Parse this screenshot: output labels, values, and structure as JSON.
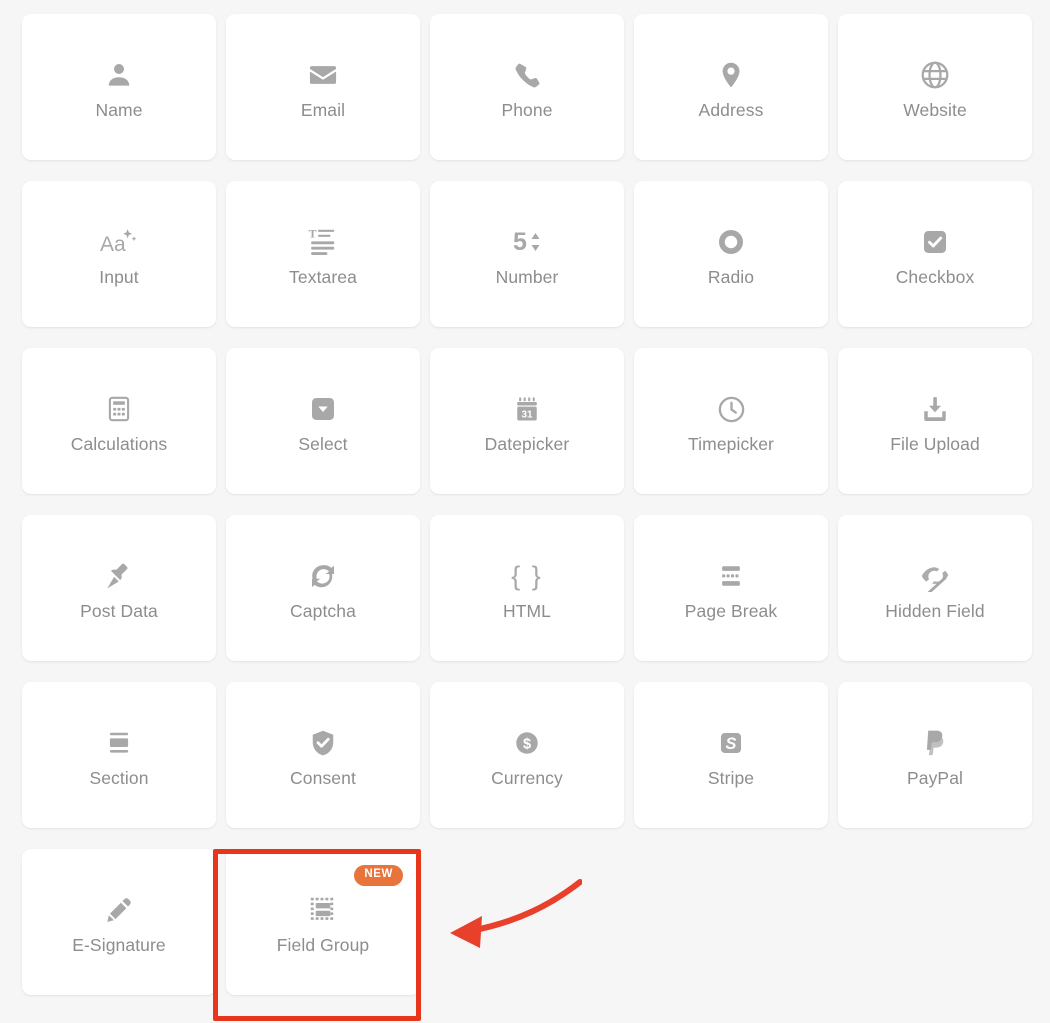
{
  "panel": {
    "name": "form-fields-palette",
    "columns": 5,
    "background_color": "#f6f6f6",
    "card_background": "#ffffff",
    "label_color": "#8d8d8d",
    "icon_color": "#a8a8a8"
  },
  "badges": {
    "new_label": "NEW",
    "new_color": "#e8743c"
  },
  "annotation": {
    "highlight_color": "#e8361c",
    "arrow_color": "#e8402a",
    "highlighted_field": "Field Group",
    "arrow_direction": "left"
  },
  "fields": [
    {
      "label": "Name",
      "icon": "user-icon",
      "new": false
    },
    {
      "label": "Email",
      "icon": "envelope-icon",
      "new": false
    },
    {
      "label": "Phone",
      "icon": "phone-icon",
      "new": false
    },
    {
      "label": "Address",
      "icon": "map-pin-icon",
      "new": false
    },
    {
      "label": "Website",
      "icon": "globe-icon",
      "new": false
    },
    {
      "label": "Input",
      "icon": "text-aa-icon",
      "new": false
    },
    {
      "label": "Textarea",
      "icon": "text-lines-icon",
      "new": false
    },
    {
      "label": "Number",
      "icon": "number-stepper-icon",
      "new": false
    },
    {
      "label": "Radio",
      "icon": "radio-circle-icon",
      "new": false
    },
    {
      "label": "Checkbox",
      "icon": "checkbox-icon",
      "new": false
    },
    {
      "label": "Calculations",
      "icon": "calculator-icon",
      "new": false
    },
    {
      "label": "Select",
      "icon": "dropdown-icon",
      "new": false
    },
    {
      "label": "Datepicker",
      "icon": "calendar-icon",
      "new": false
    },
    {
      "label": "Timepicker",
      "icon": "clock-icon",
      "new": false
    },
    {
      "label": "File Upload",
      "icon": "upload-tray-icon",
      "new": false
    },
    {
      "label": "Post Data",
      "icon": "pushpin-icon",
      "new": false
    },
    {
      "label": "Captcha",
      "icon": "refresh-icon",
      "new": false
    },
    {
      "label": "HTML",
      "icon": "curly-braces-icon",
      "new": false
    },
    {
      "label": "Page Break",
      "icon": "page-break-icon",
      "new": false
    },
    {
      "label": "Hidden Field",
      "icon": "eye-slash-icon",
      "new": false
    },
    {
      "label": "Section",
      "icon": "section-bars-icon",
      "new": false
    },
    {
      "label": "Consent",
      "icon": "shield-check-icon",
      "new": false
    },
    {
      "label": "Currency",
      "icon": "dollar-coin-icon",
      "new": false
    },
    {
      "label": "Stripe",
      "icon": "stripe-icon",
      "new": false
    },
    {
      "label": "PayPal",
      "icon": "paypal-icon",
      "new": false
    },
    {
      "label": "E-Signature",
      "icon": "pencil-icon",
      "new": false
    },
    {
      "label": "Field Group",
      "icon": "field-group-icon",
      "new": true
    }
  ],
  "calendar_day": "31",
  "number_sample": "5",
  "aa_sample": "Aa",
  "braces_sample": "{ }",
  "stripe_letter": "S"
}
